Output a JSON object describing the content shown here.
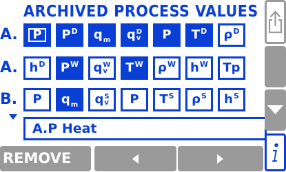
{
  "title": "ARCHIVED PROCESS VALUES",
  "rows": [
    {
      "label": "A.",
      "cells": [
        {
          "base": "P",
          "selected": true,
          "style": "box"
        },
        {
          "base": "P",
          "sup": "D",
          "selected": true
        },
        {
          "base": "q",
          "sub": "m",
          "selected": true
        },
        {
          "base": "q",
          "stack": [
            "D",
            "v"
          ],
          "selected": true
        },
        {
          "base": "P",
          "selected": true
        },
        {
          "base": "T",
          "sup": "D",
          "selected": true
        },
        {
          "base": "ρ",
          "sup": "D",
          "selected": false
        }
      ]
    },
    {
      "label": "A.",
      "cells": [
        {
          "base": "h",
          "sup": "D",
          "selected": false
        },
        {
          "base": "P",
          "sup": "W",
          "selected": true
        },
        {
          "base": "q",
          "stack": [
            "W",
            "v"
          ],
          "selected": false
        },
        {
          "base": "T",
          "sup": "W",
          "selected": true
        },
        {
          "base": "ρ",
          "sup": "W",
          "selected": false
        },
        {
          "base": "h",
          "sup": "W",
          "selected": false
        },
        {
          "base": "Tp",
          "selected": false
        }
      ]
    },
    {
      "label": "B.",
      "cells": [
        {
          "base": "P",
          "selected": false
        },
        {
          "base": "q",
          "sub": "m",
          "selected": true
        },
        {
          "base": "q",
          "stack": [
            "S",
            "v"
          ],
          "selected": false
        },
        {
          "base": "P",
          "selected": false
        },
        {
          "base": "T",
          "sup": "S",
          "selected": false
        },
        {
          "base": "ρ",
          "sup": "S",
          "selected": false
        },
        {
          "base": "h",
          "sup": "S",
          "selected": false
        }
      ]
    }
  ],
  "description": "A.P   Heat",
  "bottom": {
    "remove_label": "REMOVE"
  },
  "colors": {
    "accent": "#0a3fd6",
    "button_gray": "#9a9a9a",
    "background": "#ffffff"
  },
  "icons": {
    "side_top": "export-icon",
    "side_mid": "blank-button",
    "side_down": "down-arrow-icon",
    "side_info": "info-icon",
    "left": "left-arrow-icon",
    "right": "right-arrow-icon"
  }
}
